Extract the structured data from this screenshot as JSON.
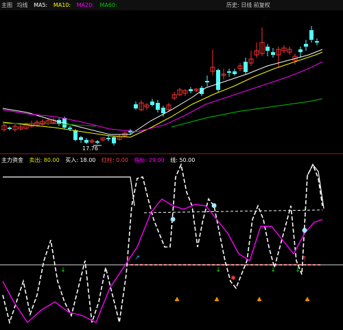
{
  "top_bar": {
    "left_items": [
      {
        "text": "主图",
        "color": "#c8c8c8"
      },
      {
        "text": "均线",
        "color": "#c8c8c8"
      },
      {
        "text": "MA5:",
        "color": "#ffffff"
      },
      {
        "text": "MA10:",
        "color": "#ffff00"
      },
      {
        "text": "MA20:",
        "color": "#ff00ff"
      },
      {
        "text": "MA60:",
        "color": "#00c800"
      }
    ],
    "right_text": "历史:  日线  前复权"
  },
  "indicator_bar": {
    "items": [
      {
        "text": "主力资金",
        "color": "#ffffff"
      },
      {
        "text": "卖出: 80.00",
        "color": "#e0e000"
      },
      {
        "text": "买入: 18.00",
        "color": "#ffffff"
      },
      {
        "text": "红柱: 0.00",
        "color": "#ff4040"
      },
      {
        "text": "指标: 29.00",
        "color": "#ff00ff"
      },
      {
        "text": "线: 50.00",
        "color": "#ffffff"
      }
    ]
  },
  "price_annotations": {
    "low_label": "17.76"
  },
  "colors": {
    "background": "#000000",
    "up_candle": "#ff3232",
    "down_candle": "#54fcfc",
    "ma5": "#ffffff",
    "ma10": "#ffff00",
    "ma20": "#ff00ff",
    "ma60": "#00c800",
    "osc_line": "#ffffff",
    "signal_line": "#ff00ff",
    "threshold_line": "#ff8c8c",
    "buy_marker": "#00ff00",
    "sell_marker": "#ff4040",
    "divider": "#9b1c1c"
  }
}
